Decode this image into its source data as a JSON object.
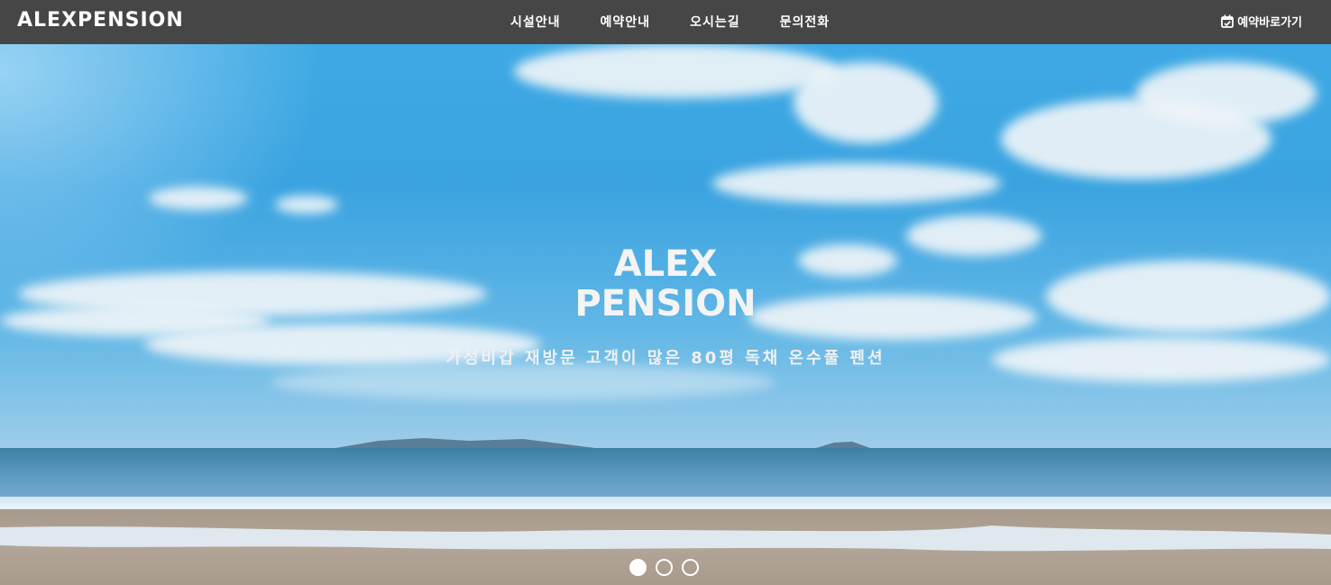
{
  "navbar": {
    "logo": "ALEXPENSION",
    "menu": [
      "시설안내",
      "예약안내",
      "오시는길",
      "문의전화"
    ],
    "reserve_label": "예약바로가기",
    "reserve_icon": "calendar-check-icon",
    "background": "#464646"
  },
  "hero": {
    "title_line1": "ALEX",
    "title_line2": "PENSION",
    "subtitle": "가성비갑 재방문 고객이 많은 80평 독채 온수풀 펜션",
    "slide_count": 3,
    "active_slide": 1
  }
}
